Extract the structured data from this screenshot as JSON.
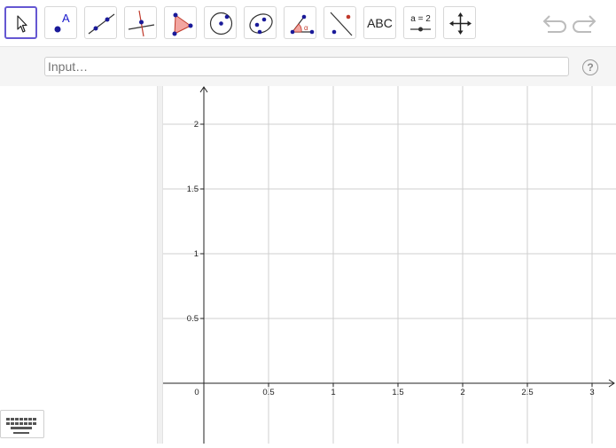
{
  "toolbar": {
    "tools": [
      {
        "name": "move-tool",
        "icon": "cursor-arrow-icon",
        "active": true
      },
      {
        "name": "point-tool",
        "icon": "point-icon",
        "label": "A"
      },
      {
        "name": "line-tool",
        "icon": "line-icon"
      },
      {
        "name": "perpendicular-line-tool",
        "icon": "perpendicular-line-icon"
      },
      {
        "name": "polygon-tool",
        "icon": "polygon-icon"
      },
      {
        "name": "circle-tool",
        "icon": "circle-icon"
      },
      {
        "name": "conic-tool",
        "icon": "ellipse-icon"
      },
      {
        "name": "angle-tool",
        "icon": "angle-icon",
        "label": "α"
      },
      {
        "name": "reflect-tool",
        "icon": "reflect-icon"
      },
      {
        "name": "text-tool",
        "icon": "text-icon",
        "label": "ABC"
      },
      {
        "name": "slider-tool",
        "icon": "slider-icon",
        "label": "a = 2"
      },
      {
        "name": "move-graphics-tool",
        "icon": "move-cross-icon"
      }
    ],
    "undo_icon": "undo-icon",
    "redo_icon": "redo-icon"
  },
  "input_bar": {
    "placeholder": "Input…",
    "help_label": "?"
  },
  "graphics": {
    "x_ticks": [
      "0.5",
      "1",
      "1.5",
      "2",
      "2.5",
      "3"
    ],
    "y_ticks": [
      "0.5",
      "1",
      "1.5",
      "2"
    ],
    "origin_label": "0",
    "grid": true
  },
  "keyboard_icon": "keyboard-icon"
}
